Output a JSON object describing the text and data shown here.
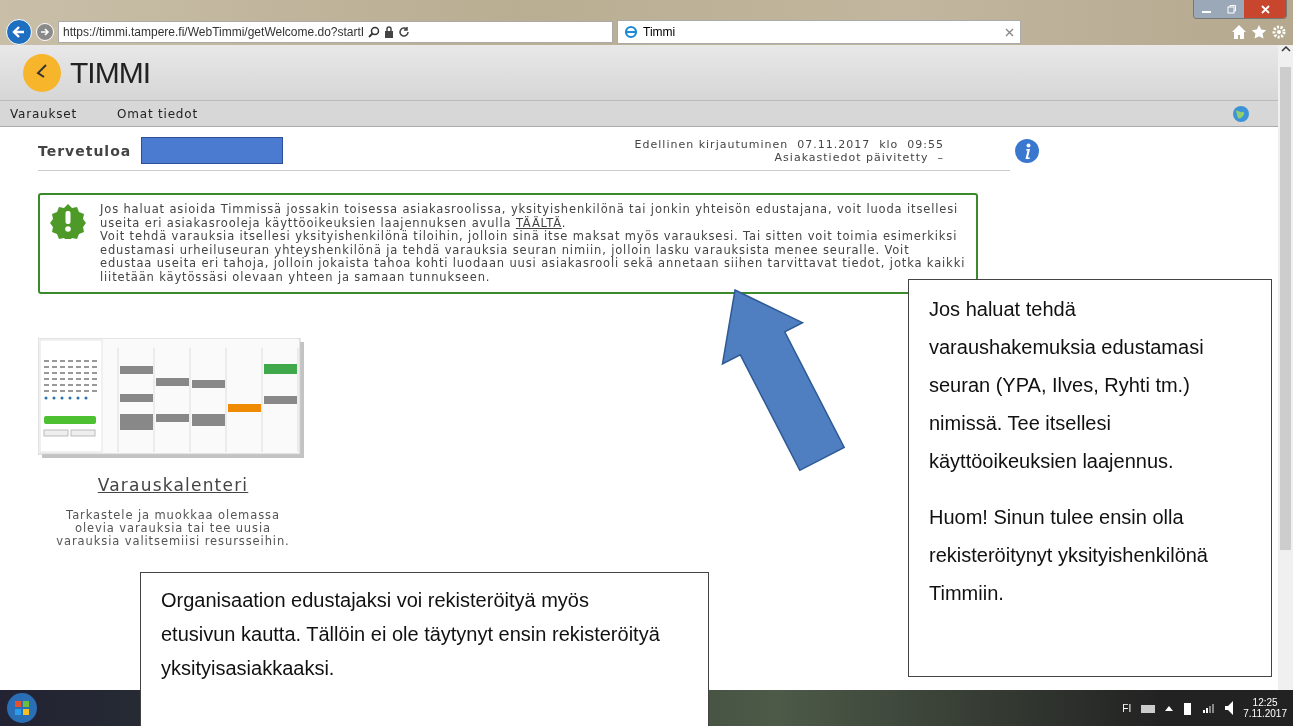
{
  "browser": {
    "address": "https://timmi.tampere.fi/WebTimmi/getWelcome.do?startI",
    "tab": "Timmi"
  },
  "app": {
    "logo": "TIMMI"
  },
  "nav": [
    {
      "label": "Varaukset"
    },
    {
      "label": "Omat tiedot"
    }
  ],
  "welcome": {
    "greeting": "Tervetuloa",
    "last_login": "Edellinen kirjautuminen  07.11.2017  klo  09:55",
    "updated": "Asiakastiedot päivitetty  –"
  },
  "notice": {
    "text_before": "Jos haluat asioida Timmissä jossakin toisessa asiakasroolissa, yksityishenkilönä tai jonkin yhteisön edustajana, voit luoda itsellesi useita eri asiakasrooleja käyttöoikeuksien laajennuksen avulla",
    "link": "TÄÄLTÄ",
    "text_after": ".",
    "paragraph": "Voit tehdä varauksia itsellesi yksityishenkilönä tiloihin, jolloin sinä itse maksat myös varauksesi. Tai sitten voit toimia esimerkiksi edustamasi urheiluseuran yhteyshenkilönä ja tehdä varauksia seuran nimiin, jolloin lasku varauksista menee seuralle. Voit edustaa useita eri tahoja, jolloin jokaista tahoa kohti luodaan uusi asiakasrooli sekä annetaan siihen tarvittavat tiedot, jotka kaikki liitetään käytössäsi olevaan yhteen ja samaan tunnukseen."
  },
  "tile": {
    "title": "Varauskalenteri",
    "description": "Tarkastele ja muokkaa olemassa olevia varauksia tai tee uusia varauksia valitsemiisi resursseihin."
  },
  "callouts": [
    {
      "kind": "bottom",
      "paragraphs": [
        "Organisaation edustajaksi voi rekisteröityä myös etusivun kautta. Tällöin ei ole täytynyt ensin rekisteröityä yksityisasiakkaaksi."
      ]
    },
    {
      "kind": "right",
      "paragraphs": [
        "Jos haluat tehdä varaushakemuksia edustamasi seuran (YPA, Ilves, Ryhti tm.) nimissä. Tee itsellesi käyttöoikeuksien laajennus.",
        "Huom! Sinun tulee ensin olla rekisteröitynyt yksityishenkilönä Timmiin."
      ]
    }
  ],
  "taskbar": {
    "language": "FI",
    "time": "12:25",
    "date": "7.11.2017"
  }
}
